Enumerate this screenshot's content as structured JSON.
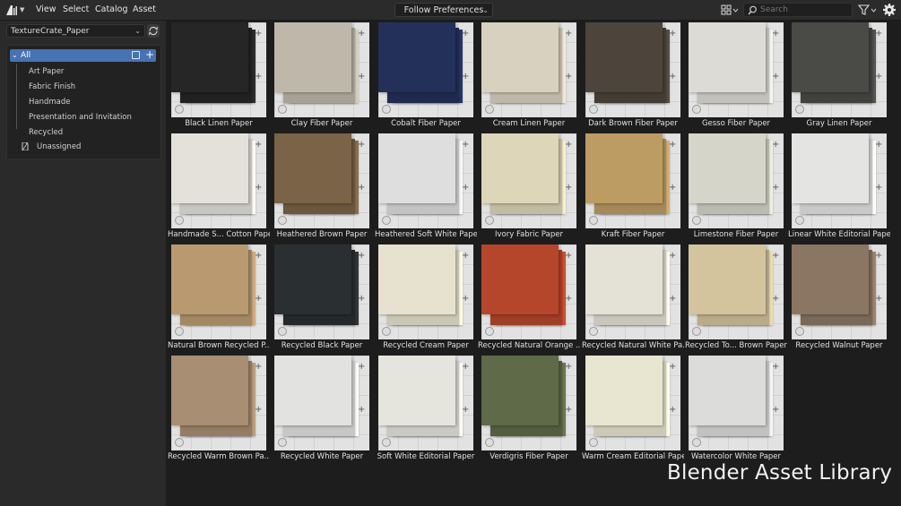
{
  "topbar": {
    "menus": [
      "View",
      "Select",
      "Catalog",
      "Asset"
    ],
    "import_method": "Follow Preferences",
    "search_placeholder": "Search",
    "icons": {
      "editor_type": "asset-browser-icon",
      "display": "grid-view-icon",
      "filter": "filter-icon",
      "settings": "gear-icon"
    }
  },
  "sidebar": {
    "library": "TextureCrate_Paper",
    "catalog_root": "All",
    "catalogs": [
      "Art Paper",
      "Fabric Finish",
      "Handmade",
      "Presentation and Invitation",
      "Recycled"
    ],
    "unassigned": "Unassigned"
  },
  "assets": [
    {
      "name": "Black Linen Paper",
      "color": "#262626"
    },
    {
      "name": "Clay Fiber Paper",
      "color": "#bfb8aa"
    },
    {
      "name": "Cobalt Fiber Paper",
      "color": "#23305a"
    },
    {
      "name": "Cream Linen Paper",
      "color": "#d9d1bf"
    },
    {
      "name": "Dark Brown Fiber Paper",
      "color": "#4d453b"
    },
    {
      "name": "Gesso Fiber Paper",
      "color": "#dcdbd6"
    },
    {
      "name": "Gray Linen Paper",
      "color": "#4a4a47"
    },
    {
      "name": "Handmade S... Cotton Paper",
      "color": "#e3e1da"
    },
    {
      "name": "Heathered Brown Paper",
      "color": "#7a6346"
    },
    {
      "name": "Heathered Soft White Paper",
      "color": "#dedede"
    },
    {
      "name": "Ivory Fabric Paper",
      "color": "#ddd6b8"
    },
    {
      "name": "Kraft Fiber Paper",
      "color": "#bd9c64"
    },
    {
      "name": "Limestone Fiber Paper",
      "color": "#d6d5c9"
    },
    {
      "name": "Linear White Editorial Paper",
      "color": "#e4e4e2"
    },
    {
      "name": "Natural Brown Recycled P...",
      "color": "#b99a70"
    },
    {
      "name": "Recycled Black Paper",
      "color": "#2a2f31"
    },
    {
      "name": "Recycled Cream Paper",
      "color": "#e6e2cf"
    },
    {
      "name": "Recycled Natural Orange ...",
      "color": "#b6462b"
    },
    {
      "name": "Recycled Natural White Pa...",
      "color": "#e4e2d6"
    },
    {
      "name": "Recycled To... Brown Paper",
      "color": "#d3c49e"
    },
    {
      "name": "Recycled Walnut Paper",
      "color": "#8a7662"
    },
    {
      "name": "Recycled Warm Brown Pa...",
      "color": "#a88e72"
    },
    {
      "name": "Recycled White Paper",
      "color": "#e2e2e0"
    },
    {
      "name": "Soft White Editorial Paper",
      "color": "#e5e4dd"
    },
    {
      "name": "Verdigris Fiber Paper",
      "color": "#5e6a48"
    },
    {
      "name": "Warm Cream Editorial Paper",
      "color": "#e8e5d0"
    },
    {
      "name": "Watercolor White Paper",
      "color": "#dcdcda"
    }
  ],
  "watermark": "Blender Asset Library"
}
